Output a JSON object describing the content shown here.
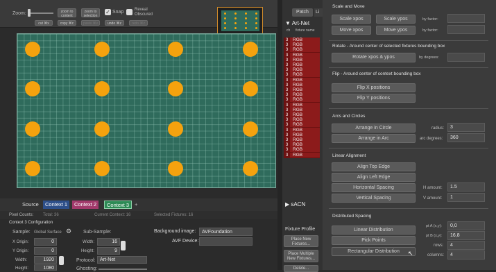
{
  "toolbar": {
    "zoom_label": "Zoom:",
    "zoom_content_button": "zoom to content",
    "zoom_selection_button": "zoom to selection",
    "cut_button": "cut ⌘x",
    "copy_button": "copy ⌘c",
    "paste_button": "paste ⌘v",
    "undo_button": "undo ⌘z",
    "redo_button": "redo ⌘z",
    "snap_label": "Snap",
    "reveal_label": "Reveal Obscured"
  },
  "context_tabs": {
    "source": "Source",
    "context1": "Context 1",
    "context2": "Context 2",
    "context3": "Context 3",
    "add": "+"
  },
  "status": {
    "pixel_counts_label": "Pixel Counts:",
    "total": "Total: 36",
    "current_context": "Current Context: 16",
    "selected_fixtures": "Selected Fixtures: 16"
  },
  "config": {
    "title": "Context 3 Configuration",
    "sample_label": "Sample:",
    "sample_value": "Global Surface",
    "sub_sample_label": "Sub-Sample:",
    "background_image_label": "Background image:",
    "background_image_value": "AVFoundation",
    "avf_device_label": "AVF Device:",
    "x_origin_label": "X Origin:",
    "x_origin_value": "0",
    "y_origin_label": "Y Origin:",
    "y_origin_value": "0",
    "width_label": "Width:",
    "width_value": "1920",
    "height_label": "Height:",
    "height_value": "1080",
    "sub_width_label": "Width:",
    "sub_width_value": "16",
    "sub_height_label": "Height:",
    "sub_height_value": "9",
    "protocol_label": "Protocol:",
    "protocol_value": "Art-Net",
    "ghosting_label": "Ghosting:"
  },
  "patch_panel": {
    "tab_patch": "Patch",
    "tab_other": "Li",
    "artnet_header": "Art-Net",
    "col_ch": "ch",
    "col_fixture": "fixture name",
    "rows": [
      {
        "num": "3",
        "name": "RGB"
      },
      {
        "num": "3",
        "name": "RGB"
      },
      {
        "num": "3",
        "name": "RGB"
      },
      {
        "num": "3",
        "name": "RGB"
      },
      {
        "num": "3",
        "name": "RGB"
      },
      {
        "num": "3",
        "name": "RGB"
      },
      {
        "num": "3",
        "name": "RGB"
      },
      {
        "num": "3",
        "name": "RGB"
      },
      {
        "num": "3",
        "name": "RGB"
      },
      {
        "num": "3",
        "name": "RGB"
      },
      {
        "num": "3",
        "name": "RGB"
      },
      {
        "num": "3",
        "name": "RGB"
      },
      {
        "num": "3",
        "name": "RGB"
      },
      {
        "num": "3",
        "name": "RGB"
      },
      {
        "num": "3",
        "name": "RGB"
      },
      {
        "num": "3",
        "name": "RGB"
      },
      {
        "num": "3",
        "name": "RGB"
      },
      {
        "num": "3",
        "name": "RGB"
      },
      {
        "num": "3",
        "name": "RGB"
      },
      {
        "num": "3",
        "name": "RGB"
      },
      {
        "num": "3",
        "name": "RGB"
      },
      {
        "num": "3",
        "name": "RGB"
      },
      {
        "num": "3",
        "name": "RGB"
      },
      {
        "num": "3",
        "name": "RGB"
      }
    ],
    "sacn_header": "sACN",
    "fixture_profile_label": "Fixture Profile",
    "place_new_button": "Place New Fixtures...",
    "place_multiple_button": "Place Multiple New Fixtures...",
    "delete_button": "Delete..."
  },
  "transform_panel": {
    "scale_section": "Scale and Move",
    "scale_xpos": "Scale xpos",
    "scale_ypos": "Scale ypos",
    "by_factor1": "by factor:",
    "move_xpos": "Move xpos",
    "move_ypos": "Move ypos",
    "by_factor2": "by factor:",
    "rotate_section": "Rotate - Around center of selected fixtures bounding box",
    "rotate_button": "Rotate xpos & ypos",
    "by_degrees": "by degrees:",
    "flip_section": "Flip - Around center of context bounding box",
    "flip_x": "Flip X positions",
    "flip_y": "Flip Y positions",
    "arcs_section": "Arcs and Circles",
    "arrange_circle": "Arrange in Circle",
    "radius_label": "radius:",
    "radius_value": "3",
    "arrange_arc": "Arrange in Arc",
    "arc_degrees_label": "arc degrees:",
    "arc_degrees_value": "360",
    "linear_section": "Linear Alignment",
    "align_top": "Align Top Edge",
    "align_left": "Align Left Edge",
    "horizontal_spacing": "Horizontal Spacing",
    "h_amount_label": "H amount:",
    "h_amount_value": "1.5",
    "vertical_spacing": "Vertical Spacing",
    "v_amount_label": "V amount:",
    "v_amount_value": "1",
    "distributed_section": "Distributed Spacing",
    "linear_distribution": "Linear Distribution",
    "pt_a_label": "pt A (x,y):",
    "pt_a_value": "0,0",
    "pick_points": "Pick Points",
    "pt_b_label": "pt B (x,y):",
    "pt_b_value": "16,8",
    "rows_label": "rows:",
    "rows_value": "4",
    "rect_distribution": "Rectangular Distribution",
    "columns_label": "columns:",
    "columns_value": "4"
  },
  "colors": {
    "canvas": "#2f6b5c",
    "fixture_dot": "#f5a20e",
    "patch_row": "#8c1b1b",
    "context2_tab": "#a23a6b",
    "context3_tab": "#2d8a55"
  }
}
